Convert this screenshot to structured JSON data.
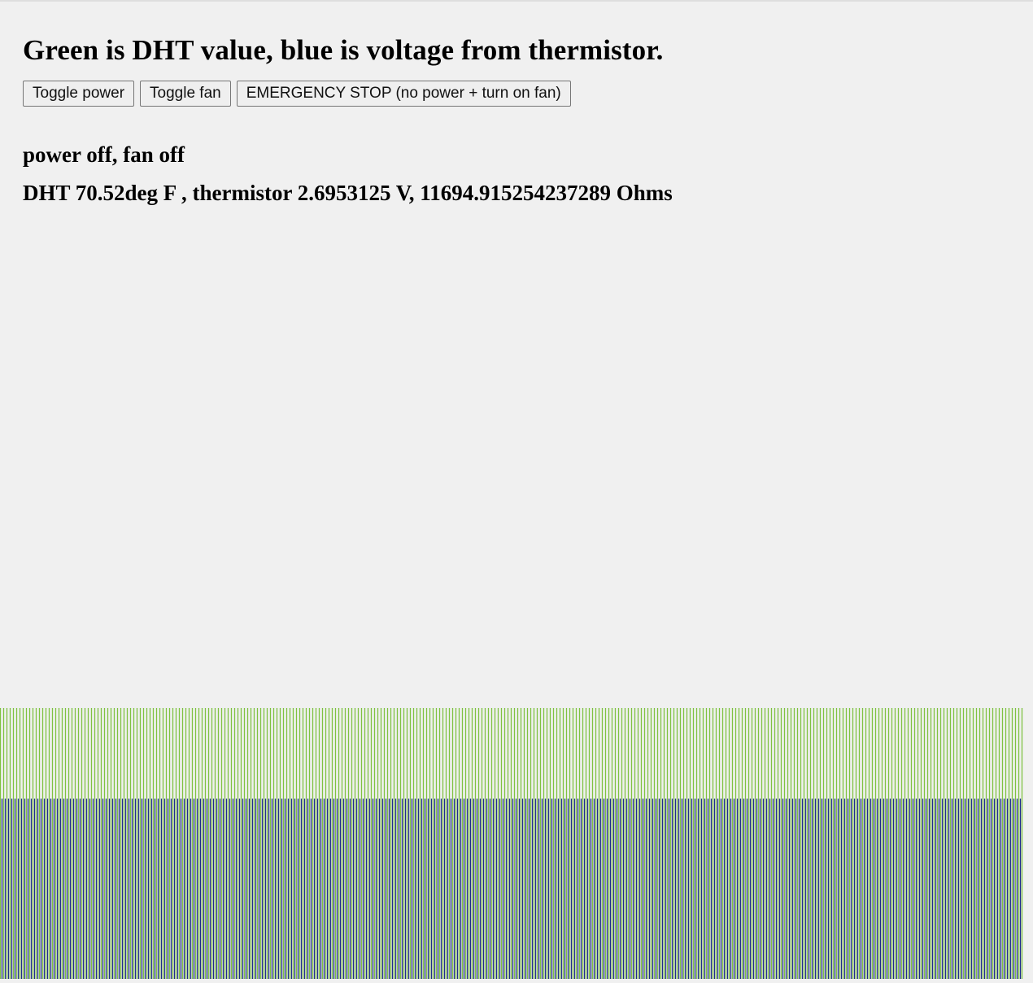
{
  "header": {
    "title": "Green is DHT value, blue is voltage from thermistor."
  },
  "controls": {
    "toggle_power_label": "Toggle power",
    "toggle_fan_label": "Toggle fan",
    "emergency_stop_label": "EMERGENCY STOP (no power + turn on fan)"
  },
  "status": {
    "power_fan": "power off, fan off",
    "readings": "DHT 70.52deg F , thermistor 2.6953125 V, 11694.915254237289 Ohms"
  },
  "colors": {
    "background": "#f0f0f0",
    "dht_line": "#7fc241",
    "thermistor_line": "#1f2a8c"
  },
  "chart_data": {
    "type": "bar",
    "series": [
      {
        "name": "DHT",
        "color": "#7fc241",
        "level": 1.0
      },
      {
        "name": "thermistor",
        "color": "#1f2a8c",
        "level": 0.665
      }
    ]
  }
}
